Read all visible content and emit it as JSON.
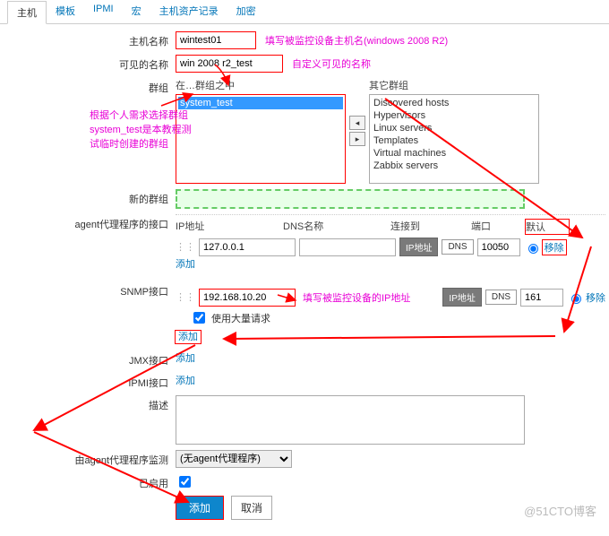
{
  "tabs": [
    "主机",
    "模板",
    "IPMI",
    "宏",
    "主机资产记录",
    "加密"
  ],
  "hostname": {
    "label": "主机名称",
    "value": "wintest01",
    "ann": "填写被监控设备主机名(windows 2008 R2)"
  },
  "visiblename": {
    "label": "可见的名称",
    "value": "win 2008 r2_test",
    "ann": "自定义可见的名称"
  },
  "groups": {
    "label": "群组",
    "in_label": "在…群组之中",
    "other_label": "其它群组",
    "selected": "system_test",
    "others": [
      "Discovered hosts",
      "Hypervisors",
      "Linux servers",
      "Templates",
      "Virtual machines",
      "Zabbix servers"
    ],
    "ann_line1": "根据个人需求选择群组",
    "ann_line2": "system_test是本教程测",
    "ann_line3": "试临时创建的群组"
  },
  "newgroup": {
    "label": "新的群组"
  },
  "agent": {
    "label": "agent代理程序的接口",
    "headers": {
      "ip": "IP地址",
      "dns": "DNS名称",
      "conn": "连接到",
      "port": "端口",
      "def": "默认"
    },
    "ip": "127.0.0.1",
    "dns": "",
    "port": "10050",
    "btn_ip": "IP地址",
    "btn_dns": "DNS",
    "remove": "移除",
    "add": "添加"
  },
  "snmp": {
    "label": "SNMP接口",
    "ip": "192.168.10.20",
    "dns": "",
    "port": "161",
    "btn_ip": "IP地址",
    "btn_dns": "DNS",
    "ann": "填写被监控设备的IP地址",
    "bulk": "使用大量请求",
    "remove": "移除",
    "add": "添加"
  },
  "jmx": {
    "label": "JMX接口",
    "add": "添加"
  },
  "ipmi": {
    "label": "IPMI接口",
    "add": "添加"
  },
  "desc": {
    "label": "描述"
  },
  "proxy": {
    "label": "由agent代理程序监测",
    "value": "(无agent代理程序)"
  },
  "enable": {
    "label": "已启用"
  },
  "buttons": {
    "add": "添加",
    "cancel": "取消"
  },
  "watermark": "@51CTO博客"
}
